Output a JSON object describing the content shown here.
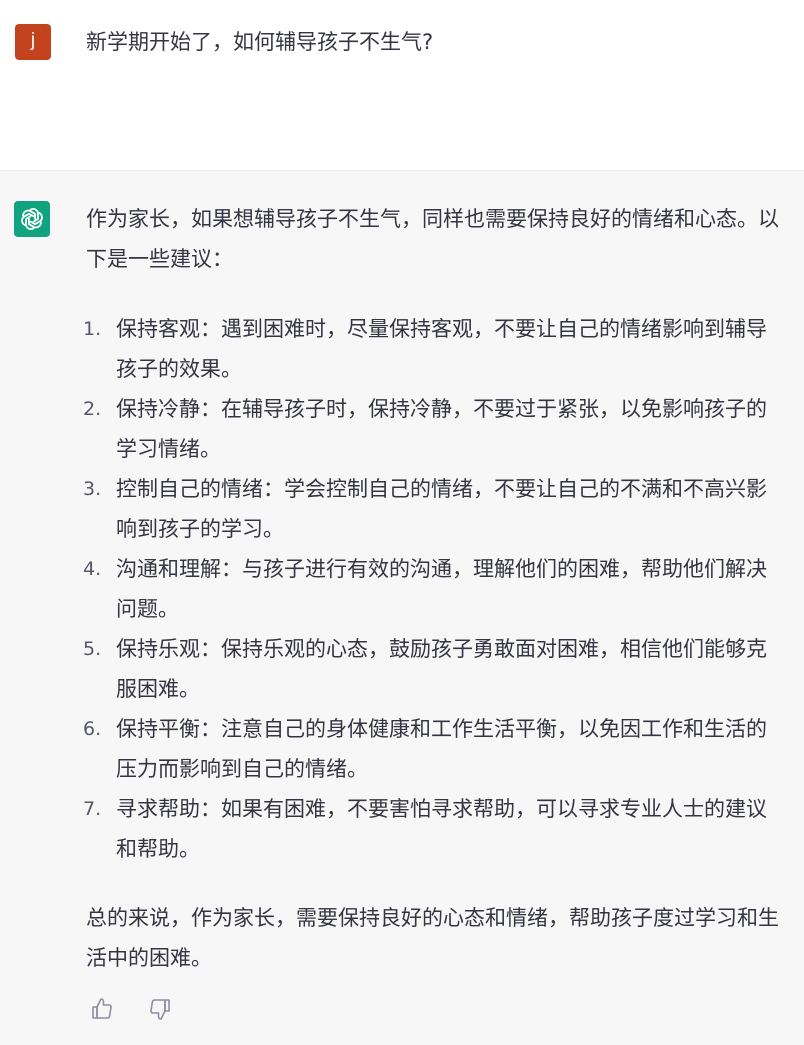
{
  "user_message": {
    "avatar_letter": "j",
    "text": "新学期开始了，如何辅导孩子不生气?"
  },
  "assistant_message": {
    "intro": "作为家长，如果想辅导孩子不生气，同样也需要保持良好的情绪和心态。以下是一些建议：",
    "items": [
      {
        "num": "1.",
        "text": "保持客观：遇到困难时，尽量保持客观，不要让自己的情绪影响到辅导孩子的效果。"
      },
      {
        "num": "2.",
        "text": "保持冷静：在辅导孩子时，保持冷静，不要过于紧张，以免影响孩子的学习情绪。"
      },
      {
        "num": "3.",
        "text": "控制自己的情绪：学会控制自己的情绪，不要让自己的不满和不高兴影响到孩子的学习。"
      },
      {
        "num": "4.",
        "text": "沟通和理解：与孩子进行有效的沟通，理解他们的困难，帮助他们解决问题。"
      },
      {
        "num": "5.",
        "text": "保持乐观：保持乐观的心态，鼓励孩子勇敢面对困难，相信他们能够克服困难。"
      },
      {
        "num": "6.",
        "text": "保持平衡：注意自己的身体健康和工作生活平衡，以免因工作和生活的压力而影响到自己的情绪。"
      },
      {
        "num": "7.",
        "text": "寻求帮助：如果有困难，不要害怕寻求帮助，可以寻求专业人士的建议和帮助。"
      }
    ],
    "conclusion": "总的来说，作为家长，需要保持良好的心态和情绪，帮助孩子度过学习和生活中的困难。"
  },
  "feedback": {
    "thumbs_up_icon": "thumbs-up-icon",
    "thumbs_down_icon": "thumbs-down-icon"
  },
  "colors": {
    "user_avatar": "#c4431f",
    "bot_avatar": "#10a37f",
    "assistant_bg": "#f7f7f8",
    "text": "#343541"
  }
}
